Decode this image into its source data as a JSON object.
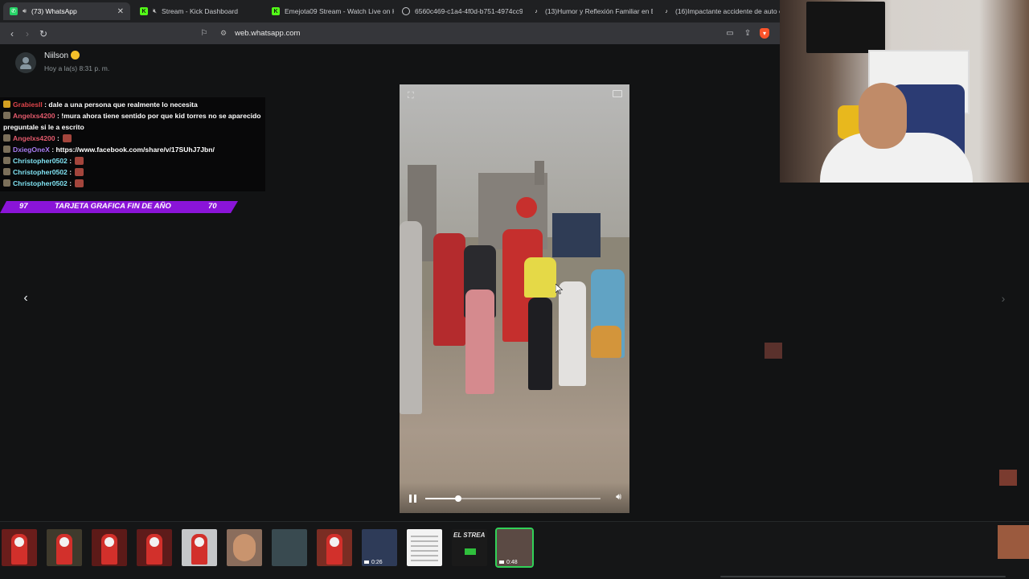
{
  "browser": {
    "tabs": [
      {
        "label": "(73) WhatsApp",
        "favicon": "whatsapp-icon",
        "active": true,
        "has_audio": true
      },
      {
        "label": "Stream - Kick Dashboard",
        "favicon": "kick-icon",
        "muted": true
      },
      {
        "label": "Emejota09 Stream - Watch Live on K",
        "favicon": "kick-icon"
      },
      {
        "label": "6560c469-c1a4-4f0d-b751-4974cc9",
        "favicon": "globe-icon"
      },
      {
        "label": "(13)Humor y Reflexión Familiar en Ba",
        "favicon": "tiktok-icon"
      },
      {
        "label": "(16)Impactante accidente de auto e",
        "favicon": "tiktok-icon"
      }
    ],
    "url": "web.whatsapp.com"
  },
  "status": {
    "sender_name": "Niilson",
    "timestamp": "Hoy a la(s) 8:31 p. m."
  },
  "video": {
    "progress": 0.19,
    "state": "playing"
  },
  "stream_chat": {
    "messages": [
      {
        "user": "Grabiesll",
        "user_color": "#e0454b",
        "text": "dale a una persona que realmente lo necesita",
        "badge": "gold"
      },
      {
        "user": "Angelxs4200",
        "user_color": "#e45a6c",
        "text": "!mura ahora tiene sentido por que kid torres no se aparecido preguntale si le a escrito",
        "badge": "sub"
      },
      {
        "user": "Angelxs4200",
        "user_color": "#e45a6c",
        "text": "",
        "emote": true,
        "badge": "sub"
      },
      {
        "user": "DxiegOneX",
        "user_color": "#a77cf0",
        "text": "https://www.facebook.com/share/v/17SUhJ7Jbn/",
        "badge": "sub"
      },
      {
        "user": "Christopher0502",
        "user_color": "#7fe0f0",
        "text": "",
        "emote": true,
        "badge": "sub"
      },
      {
        "user": "Christopher0502",
        "user_color": "#7fe0f0",
        "text": "",
        "emote": true,
        "badge": "sub"
      },
      {
        "user": "Christopher0502",
        "user_color": "#7fe0f0",
        "text": "",
        "emote": true,
        "badge": "sub"
      }
    ],
    "goal": {
      "current": "97",
      "title": "TARJETA GRAFICA FIN DE AÑO",
      "target": "70"
    }
  },
  "thumbnails": [
    {
      "theme": "santa-red",
      "bg": "#6a1d1b"
    },
    {
      "theme": "santa-tree",
      "bg": "#3f3a2c"
    },
    {
      "theme": "santa-red",
      "bg": "#5c1a18"
    },
    {
      "theme": "santa-red",
      "bg": "#5e1b1a"
    },
    {
      "theme": "santa-sleigh",
      "bg": "#c5c7c9"
    },
    {
      "theme": "face",
      "bg": "#8a6d5c"
    },
    {
      "theme": "sleigh-night",
      "bg": "#394a50"
    },
    {
      "theme": "santa-blue",
      "bg": "#7a2d23"
    },
    {
      "theme": "video",
      "bg": "#2e3b58",
      "duration": "0:26"
    },
    {
      "theme": "document",
      "bg": "#f3f3f3"
    },
    {
      "theme": "el-strea",
      "bg": "#1a1a1a",
      "overlay_text": "EL STREA"
    },
    {
      "theme": "crowd-video",
      "bg": "#5b4a44",
      "duration": "0:48",
      "active": true
    }
  ]
}
